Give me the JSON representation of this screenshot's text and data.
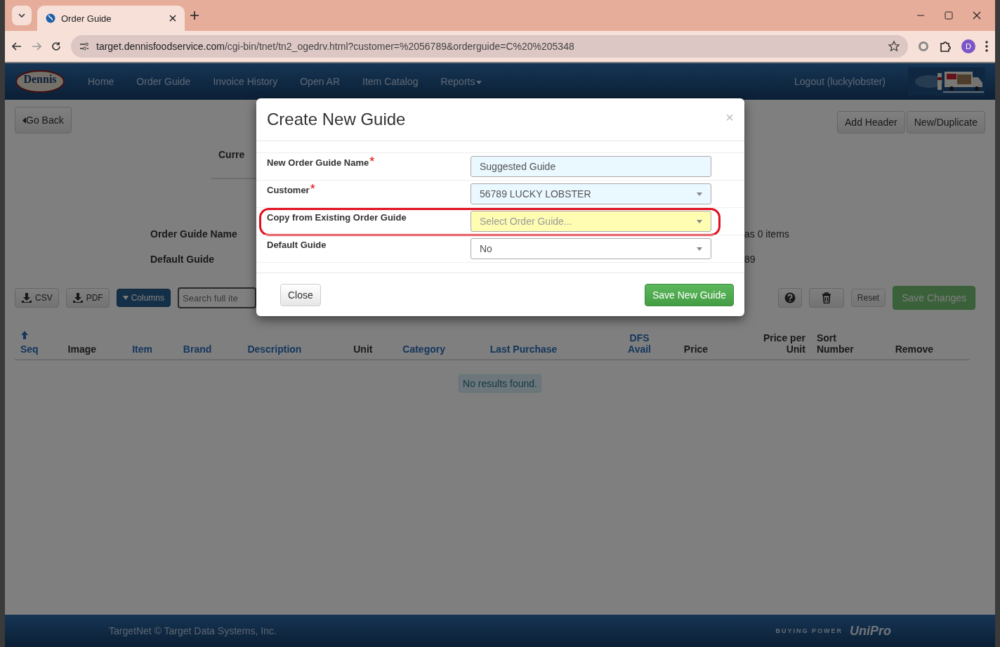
{
  "browser": {
    "tab_title": "Order Guide",
    "url_host": "target.dennisfoodservice.com",
    "url_path": "/cgi-bin/tnet/tn2_ogedrv.html?customer=%2056789&orderguide=C%20%205348",
    "avatar": "D"
  },
  "nav": {
    "logo_text": "Dennis",
    "links": [
      {
        "label": "Home",
        "dropdown": false
      },
      {
        "label": "Order Guide",
        "dropdown": false
      },
      {
        "label": "Invoice History",
        "dropdown": false
      },
      {
        "label": "Open AR",
        "dropdown": false
      },
      {
        "label": "Item Catalog",
        "dropdown": false
      },
      {
        "label": "Reports",
        "dropdown": true
      }
    ],
    "logout": "Logout (luckylobster)"
  },
  "page": {
    "go_back": "Go Back",
    "header_buttons": [
      "Add Header",
      "New/Duplicate"
    ],
    "info": {
      "current_label": "Curre",
      "rows": [
        {
          "label": "Order Guide Name",
          "note": "as 0 items"
        },
        {
          "label": "Default Guide",
          "note": "89"
        }
      ]
    },
    "toolbar": {
      "left": [
        {
          "label": "CSV",
          "kind": "download"
        },
        {
          "label": "PDF",
          "kind": "download"
        },
        {
          "label": "Columns",
          "kind": "primary"
        }
      ],
      "search_placeholder": "Search full ite",
      "right": [
        {
          "kind": "help",
          "disabled": false
        },
        {
          "kind": "trash",
          "disabled": false
        },
        {
          "kind": "text",
          "label": "Reset",
          "disabled": true
        },
        {
          "kind": "success",
          "label": "Save Changes",
          "disabled": true
        }
      ]
    },
    "table": {
      "columns": [
        {
          "label": "Seq",
          "link": true,
          "sorted": true
        },
        {
          "label": "Image",
          "link": false,
          "sorted": false
        },
        {
          "label": "Item",
          "link": true,
          "sorted": false
        },
        {
          "label": "Brand",
          "link": true,
          "sorted": false
        },
        {
          "label": "Description",
          "link": true,
          "sorted": false
        },
        {
          "label": "Unit",
          "link": false,
          "sorted": false
        },
        {
          "label": "Category",
          "link": true,
          "sorted": false
        },
        {
          "label": "Last Purchase",
          "link": true,
          "sorted": false
        },
        {
          "label": "DFS Avail",
          "link": true,
          "sorted": false
        },
        {
          "label": "Price",
          "link": false,
          "sorted": false
        },
        {
          "label": "Price per Unit",
          "link": false,
          "sorted": false
        },
        {
          "label": "Sort Number",
          "link": false,
          "sorted": false
        },
        {
          "label": "Remove",
          "link": false,
          "sorted": false
        }
      ],
      "empty_message": "No results found."
    }
  },
  "modal": {
    "title": "Create New Guide",
    "dismiss": "×",
    "required_mark": "*",
    "fields": [
      {
        "label": "New Order Guide Name",
        "required": true,
        "kind": "text",
        "value": "Suggested Guide",
        "color": "#eaf8ff",
        "highlighted": false
      },
      {
        "label": "Customer",
        "required": true,
        "kind": "select",
        "value": "56789  LUCKY LOBSTER",
        "color": "#eaf8ff",
        "highlighted": false
      },
      {
        "label": "Copy from Existing Order Guide",
        "required": false,
        "kind": "select",
        "placeholder": "Select Order Guide...",
        "color": "#fefdb2",
        "highlighted": true
      },
      {
        "label": "Default Guide",
        "required": false,
        "kind": "select",
        "value": "No",
        "color": "#ffffff",
        "highlighted": false
      }
    ],
    "close": "Close",
    "save": "Save New Guide"
  },
  "footer": {
    "copyright": "TargetNet © Target Data Systems, Inc.",
    "partner_tagline": "BUYING POWER",
    "partner_logo": "UniPro"
  }
}
